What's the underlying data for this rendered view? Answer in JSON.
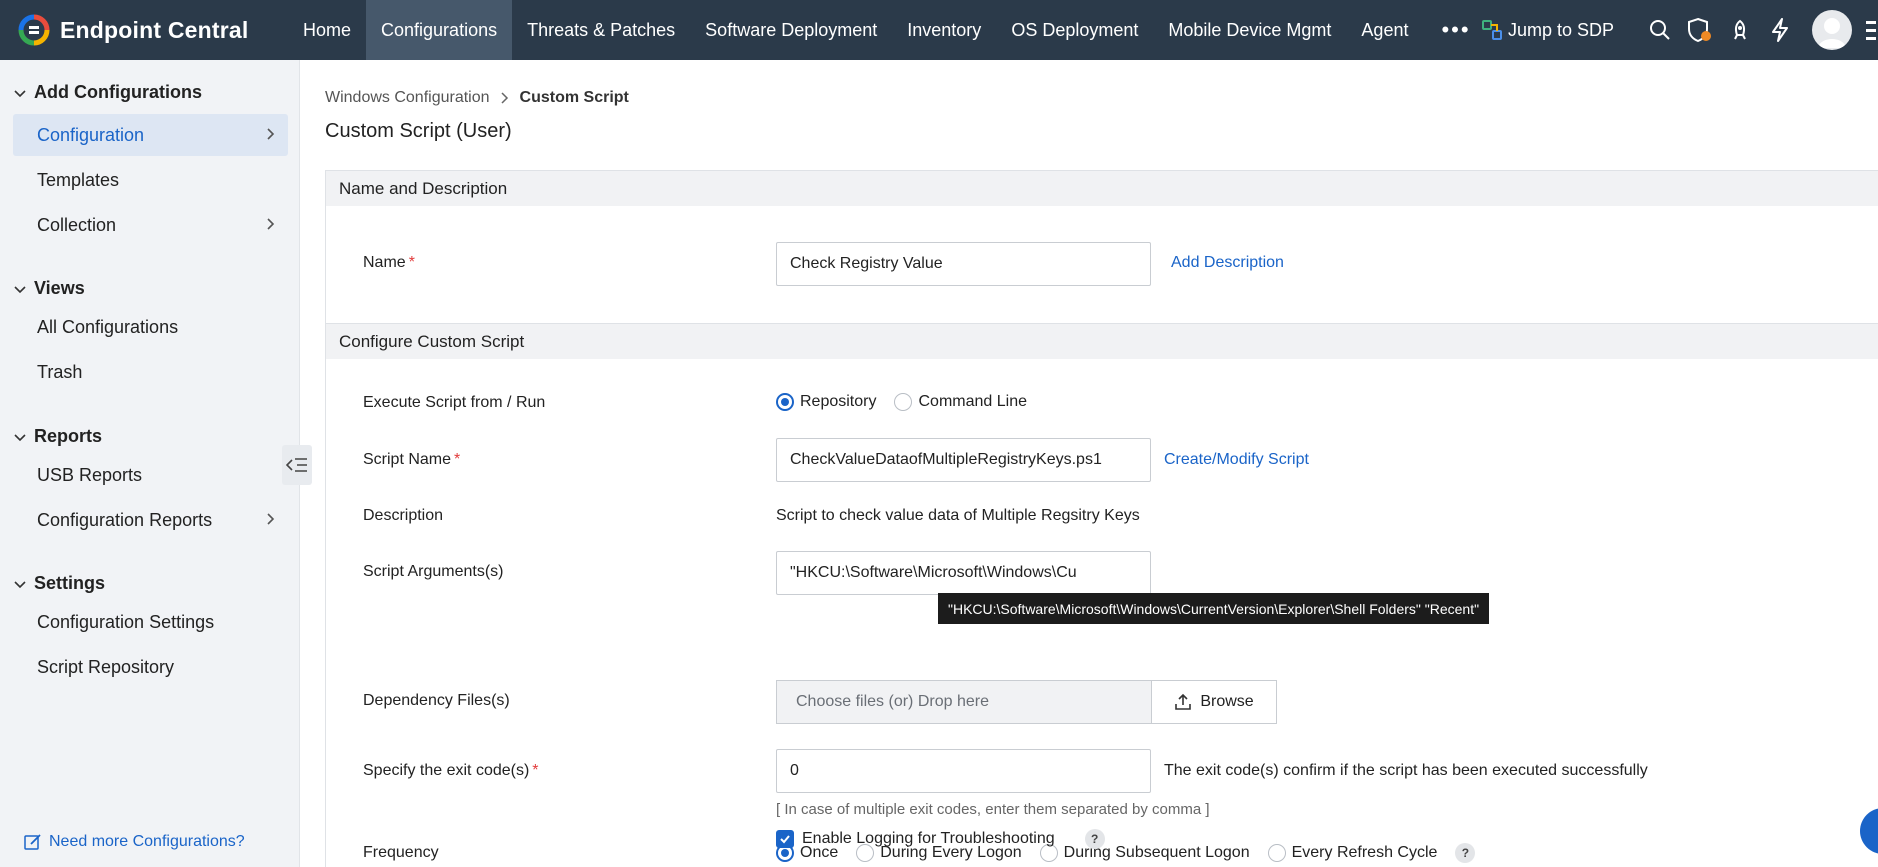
{
  "app": {
    "brand": "Endpoint Central",
    "nav": [
      "Home",
      "Configurations",
      "Threats & Patches",
      "Software Deployment",
      "Inventory",
      "OS Deployment",
      "Mobile Device Mgmt",
      "Agent"
    ],
    "more": "•••",
    "jump": "Jump to SDP"
  },
  "sidebar": {
    "sections": {
      "add": "Add Configurations",
      "views": "Views",
      "reports": "Reports",
      "settings": "Settings"
    },
    "items": {
      "configuration": "Configuration",
      "templates": "Templates",
      "collection": "Collection",
      "all_configs": "All Configurations",
      "trash": "Trash",
      "usb_reports": "USB Reports",
      "config_reports": "Configuration Reports",
      "config_settings": "Configuration Settings",
      "script_repo": "Script Repository"
    },
    "need_more": "Need more Configurations?"
  },
  "breadcrumb": {
    "parent": "Windows Configuration",
    "current": "Custom Script"
  },
  "page_title": "Custom Script (User)",
  "sections": {
    "name_desc": "Name and Description",
    "configure": "Configure Custom Script"
  },
  "form": {
    "name_label": "Name",
    "name_value": "Check Registry Value",
    "add_description": "Add Description",
    "execute_label": "Execute Script from / Run",
    "execute_options": [
      "Repository",
      "Command Line"
    ],
    "execute_selected": "Repository",
    "script_name_label": "Script Name",
    "script_name_value": "CheckValueDataofMultipleRegistryKeys.ps1",
    "create_modify": "Create/Modify Script",
    "description_label": "Description",
    "description_value": "Script to check value data of Multiple Regsitry Keys",
    "args_label": "Script Arguments(s)",
    "args_value": "\"HKCU:\\Software\\Microsoft\\Windows\\Cu",
    "args_tooltip": "\"HKCU:\\Software\\Microsoft\\Windows\\CurrentVersion\\Explorer\\Shell Folders\" \"Recent\"",
    "dependency_label": "Dependency Files(s)",
    "dependency_placeholder": "Choose files (or) Drop here",
    "browse": "Browse",
    "exit_label": "Specify the exit code(s)",
    "exit_value": "0",
    "exit_note": "The exit code(s) confirm if the script has been executed successfully",
    "exit_hint": "[ In case of multiple exit codes, enter them separated by comma ]",
    "frequency_label": "Frequency",
    "frequency_options": [
      "Once",
      "During Every Logon",
      "During Subsequent Logon",
      "Every Refresh Cycle"
    ],
    "frequency_selected": "Once",
    "logging_label": "Enable Logging for Troubleshooting",
    "logging_checked": true,
    "help": "?",
    "required_mark": "*"
  },
  "colors": {
    "nav_bg": "#2b3a4a",
    "accent": "#1a64c8",
    "sidebar_bg": "#f1f3f6",
    "required": "#e23b3b"
  }
}
